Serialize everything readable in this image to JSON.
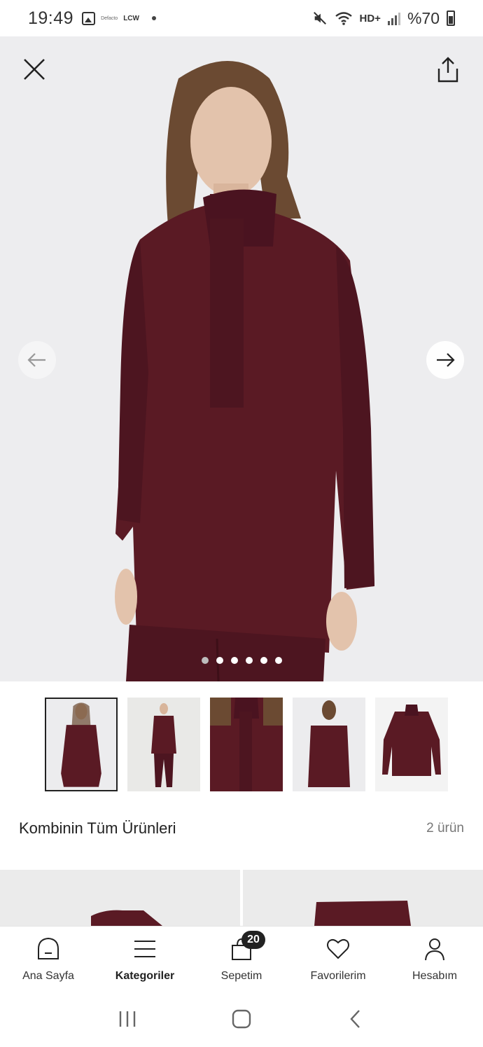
{
  "status_bar": {
    "time": "19:49",
    "brand_small": "Defacto",
    "brand": "LCW",
    "hd_label": "HD+",
    "battery_text": "%70"
  },
  "hero": {
    "image_count": 6,
    "active_index": 0,
    "garment_color": "#5a1a24",
    "background_color": "#ededef"
  },
  "thumbnails": [
    {
      "name": "front-view"
    },
    {
      "name": "full-outfit"
    },
    {
      "name": "collar-detail"
    },
    {
      "name": "back-view"
    },
    {
      "name": "flat-lay"
    }
  ],
  "combo": {
    "title": "Kombinin Tüm Ürünleri",
    "count": "2 ürün"
  },
  "bottom_nav": {
    "items": [
      {
        "label": "Ana Sayfa",
        "icon": "home-icon"
      },
      {
        "label": "Kategoriler",
        "icon": "menu-icon"
      },
      {
        "label": "Sepetim",
        "icon": "bag-icon"
      },
      {
        "label": "Favorilerim",
        "icon": "heart-icon"
      },
      {
        "label": "Hesabım",
        "icon": "user-icon"
      }
    ],
    "cart_badge": "20"
  }
}
